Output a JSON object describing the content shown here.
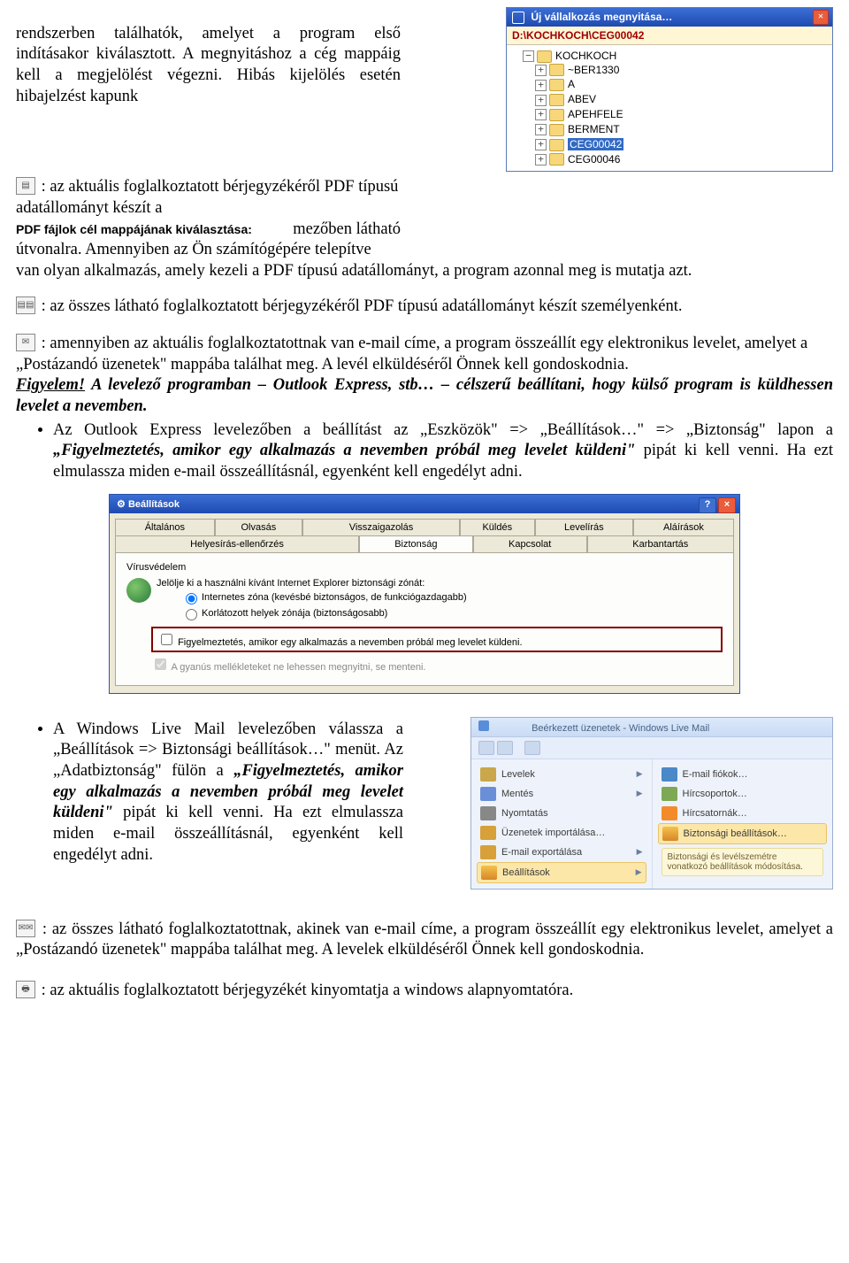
{
  "intro": {
    "p1a": "rendszerben találhatók, amelyet a program első indításakor kiválasztott. A megnyitáshoz a cég mappáig kell a megjelölést végezni. Hibás kijelölés esetén hibajelzést kapunk",
    "p2a": ": az aktuális foglalkoztatott bérjegyzékéről PDF típusú adatállományt készít a",
    "p2label": "PDF fájlok cél mappájának kiválasztása:",
    "p2b": "mezőben látható",
    "p2c": "útvonalra. Amennyiben az Ön számítógépére telepítve",
    "p2d": "van olyan alkalmazás, amely kezeli a PDF típusú adatállományt, a program azonnal meg is mutatja azt."
  },
  "tree": {
    "title": "Új vállalkozás megnyitása…",
    "path": "D:\\KOCHKOCH\\CEG00042",
    "root": "KOCHKOCH",
    "items": [
      "~BER1330",
      "A",
      "ABEV",
      "APEHFELE",
      "BERMENT",
      "CEG00042",
      "CEG00046"
    ],
    "selected": "CEG00042"
  },
  "pdf_all": ": az összes látható foglalkoztatott bérjegyzékéről PDF típusú adatállományt készít személyenként.",
  "mail": {
    "p1": ": amennyiben az aktuális foglalkoztatottnak van e-mail címe, a program összeállít egy elektronikus levelet, amelyet a „Postázandó üzenetek\" mappába találhat meg. A levél elküldéséről Önnek kell gondoskodnia.",
    "figy": "Figyelem!",
    "p2": " A levelező programban – Outlook Express, stb… – célszerű beállítani, hogy külső program is küldhessen levelet a nevemben.",
    "li1a": "Az Outlook Express levelezőben a beállítást az „Eszközök\" => „Beállítások…\" => „Biztonság\" lapon a ",
    "li1b": "„Figyelmeztetés, amikor egy alkalmazás a nevemben próbál meg levelet küldeni\"",
    "li1c": " pipát ki kell venni. Ha ezt elmulassza miden e-mail összeállításnál, egyenként kell engedélyt adni."
  },
  "settings": {
    "title": "Beállítások",
    "tabs_top": [
      "Általános",
      "Olvasás",
      "Visszaigazolás",
      "Küldés",
      "Levelírás",
      "Aláírások"
    ],
    "tabs_bottom": [
      "Helyesírás-ellenőrzés",
      "Biztonság",
      "Kapcsolat",
      "Karbantartás"
    ],
    "group": "Vírusvédelem",
    "intro": "Jelölje ki a használni kívánt Internet Explorer biztonsági zónát:",
    "opt1": "Internetes zóna (kevésbé biztonságos, de funkciógazdagabb)",
    "opt2": "Korlátozott helyek zónája (biztonságosabb)",
    "chk1": "Figyelmeztetés, amikor egy alkalmazás a nevemben próbál meg levelet küldeni.",
    "chk2": "A gyanús mellékleteket ne lehessen megnyitni, se menteni."
  },
  "wlm_text": {
    "p1a": "A Windows Live Mail levelezőben válassza a „Beállítások => Biztonsági beállítások…\" menüt. Az „Adatbiztonság\" fülön a ",
    "p1b": "„Figyelmeztetés, amikor egy alkalmazás a nevemben próbál meg levelet küldeni\"",
    "p1c": " pipát ki kell venni. Ha ezt elmulassza miden e-mail összeállításnál, egyenként kell engedélyt adni."
  },
  "wlm": {
    "title": "Beérkezett üzenetek - Windows Live Mail",
    "left": [
      {
        "k": "levelek",
        "t": "Levelek"
      },
      {
        "k": "mentes",
        "t": "Mentés"
      },
      {
        "k": "nyomtatas",
        "t": "Nyomtatás"
      },
      {
        "k": "import",
        "t": "Üzenetek importálása…"
      },
      {
        "k": "export",
        "t": "E-mail exportálása"
      },
      {
        "k": "beall",
        "t": "Beállítások"
      }
    ],
    "right": [
      {
        "k": "email",
        "t": "E-mail fiókok…"
      },
      {
        "k": "hircs",
        "t": "Hírcsoportok…"
      },
      {
        "k": "rss",
        "t": "Hírcsatornák…"
      },
      {
        "k": "bizt",
        "t": "Biztonsági beállítások…"
      }
    ],
    "tip": "Biztonsági és levélszemétre vonatkozó beállítások módosítása."
  },
  "mail_all": ": az összes látható foglalkoztatottnak, akinek van e-mail címe, a program összeállít egy elektronikus levelet, amelyet a „Postázandó üzenetek\" mappába találhat meg. A levelek elküldéséről Önnek kell gondoskodnia.",
  "print": ": az aktuális foglalkoztatott bérjegyzékét kinyomtatja a windows alapnyomtatóra."
}
